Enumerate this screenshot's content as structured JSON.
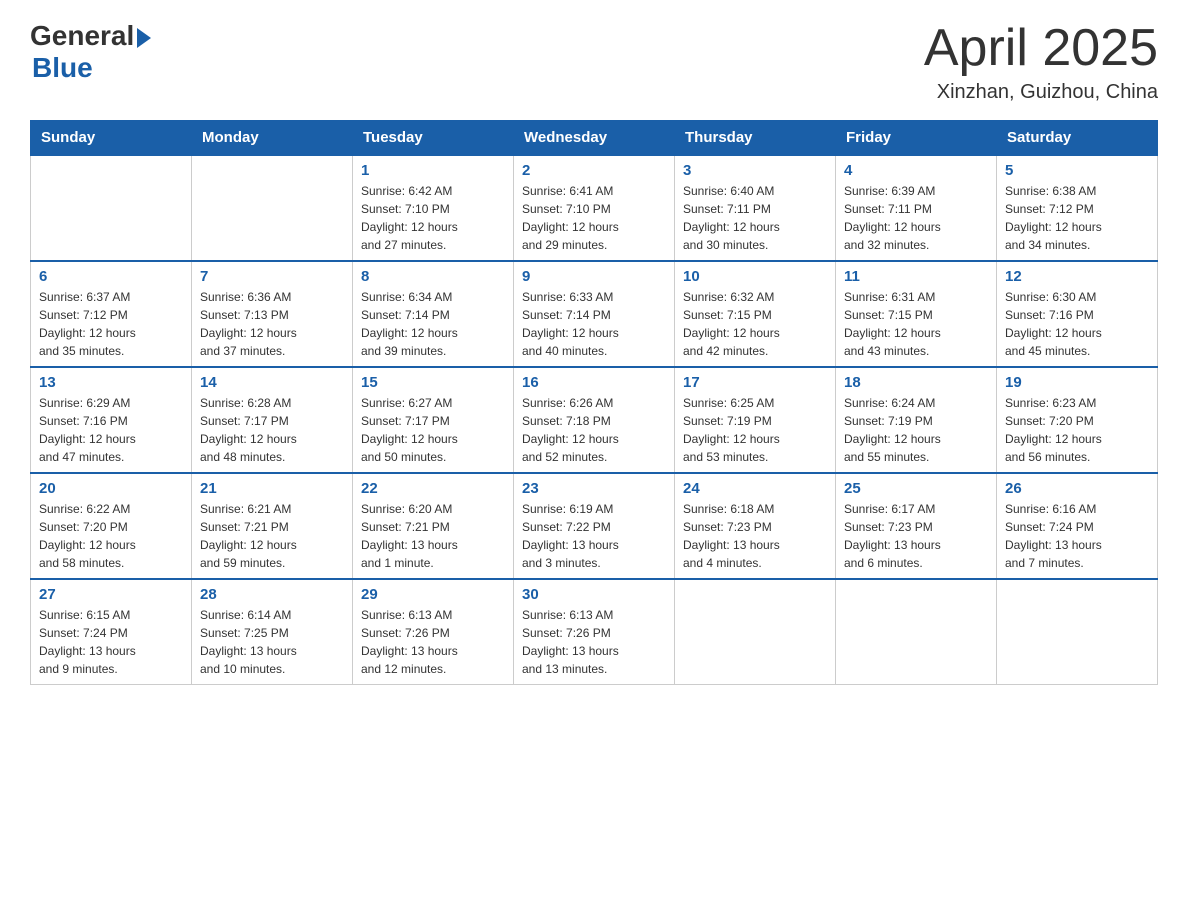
{
  "header": {
    "logo": {
      "general": "General",
      "blue": "Blue"
    },
    "title": "April 2025",
    "subtitle": "Xinzhan, Guizhou, China"
  },
  "days_of_week": [
    "Sunday",
    "Monday",
    "Tuesday",
    "Wednesday",
    "Thursday",
    "Friday",
    "Saturday"
  ],
  "weeks": [
    [
      {
        "day": "",
        "info": ""
      },
      {
        "day": "",
        "info": ""
      },
      {
        "day": "1",
        "info": "Sunrise: 6:42 AM\nSunset: 7:10 PM\nDaylight: 12 hours\nand 27 minutes."
      },
      {
        "day": "2",
        "info": "Sunrise: 6:41 AM\nSunset: 7:10 PM\nDaylight: 12 hours\nand 29 minutes."
      },
      {
        "day": "3",
        "info": "Sunrise: 6:40 AM\nSunset: 7:11 PM\nDaylight: 12 hours\nand 30 minutes."
      },
      {
        "day": "4",
        "info": "Sunrise: 6:39 AM\nSunset: 7:11 PM\nDaylight: 12 hours\nand 32 minutes."
      },
      {
        "day": "5",
        "info": "Sunrise: 6:38 AM\nSunset: 7:12 PM\nDaylight: 12 hours\nand 34 minutes."
      }
    ],
    [
      {
        "day": "6",
        "info": "Sunrise: 6:37 AM\nSunset: 7:12 PM\nDaylight: 12 hours\nand 35 minutes."
      },
      {
        "day": "7",
        "info": "Sunrise: 6:36 AM\nSunset: 7:13 PM\nDaylight: 12 hours\nand 37 minutes."
      },
      {
        "day": "8",
        "info": "Sunrise: 6:34 AM\nSunset: 7:14 PM\nDaylight: 12 hours\nand 39 minutes."
      },
      {
        "day": "9",
        "info": "Sunrise: 6:33 AM\nSunset: 7:14 PM\nDaylight: 12 hours\nand 40 minutes."
      },
      {
        "day": "10",
        "info": "Sunrise: 6:32 AM\nSunset: 7:15 PM\nDaylight: 12 hours\nand 42 minutes."
      },
      {
        "day": "11",
        "info": "Sunrise: 6:31 AM\nSunset: 7:15 PM\nDaylight: 12 hours\nand 43 minutes."
      },
      {
        "day": "12",
        "info": "Sunrise: 6:30 AM\nSunset: 7:16 PM\nDaylight: 12 hours\nand 45 minutes."
      }
    ],
    [
      {
        "day": "13",
        "info": "Sunrise: 6:29 AM\nSunset: 7:16 PM\nDaylight: 12 hours\nand 47 minutes."
      },
      {
        "day": "14",
        "info": "Sunrise: 6:28 AM\nSunset: 7:17 PM\nDaylight: 12 hours\nand 48 minutes."
      },
      {
        "day": "15",
        "info": "Sunrise: 6:27 AM\nSunset: 7:17 PM\nDaylight: 12 hours\nand 50 minutes."
      },
      {
        "day": "16",
        "info": "Sunrise: 6:26 AM\nSunset: 7:18 PM\nDaylight: 12 hours\nand 52 minutes."
      },
      {
        "day": "17",
        "info": "Sunrise: 6:25 AM\nSunset: 7:19 PM\nDaylight: 12 hours\nand 53 minutes."
      },
      {
        "day": "18",
        "info": "Sunrise: 6:24 AM\nSunset: 7:19 PM\nDaylight: 12 hours\nand 55 minutes."
      },
      {
        "day": "19",
        "info": "Sunrise: 6:23 AM\nSunset: 7:20 PM\nDaylight: 12 hours\nand 56 minutes."
      }
    ],
    [
      {
        "day": "20",
        "info": "Sunrise: 6:22 AM\nSunset: 7:20 PM\nDaylight: 12 hours\nand 58 minutes."
      },
      {
        "day": "21",
        "info": "Sunrise: 6:21 AM\nSunset: 7:21 PM\nDaylight: 12 hours\nand 59 minutes."
      },
      {
        "day": "22",
        "info": "Sunrise: 6:20 AM\nSunset: 7:21 PM\nDaylight: 13 hours\nand 1 minute."
      },
      {
        "day": "23",
        "info": "Sunrise: 6:19 AM\nSunset: 7:22 PM\nDaylight: 13 hours\nand 3 minutes."
      },
      {
        "day": "24",
        "info": "Sunrise: 6:18 AM\nSunset: 7:23 PM\nDaylight: 13 hours\nand 4 minutes."
      },
      {
        "day": "25",
        "info": "Sunrise: 6:17 AM\nSunset: 7:23 PM\nDaylight: 13 hours\nand 6 minutes."
      },
      {
        "day": "26",
        "info": "Sunrise: 6:16 AM\nSunset: 7:24 PM\nDaylight: 13 hours\nand 7 minutes."
      }
    ],
    [
      {
        "day": "27",
        "info": "Sunrise: 6:15 AM\nSunset: 7:24 PM\nDaylight: 13 hours\nand 9 minutes."
      },
      {
        "day": "28",
        "info": "Sunrise: 6:14 AM\nSunset: 7:25 PM\nDaylight: 13 hours\nand 10 minutes."
      },
      {
        "day": "29",
        "info": "Sunrise: 6:13 AM\nSunset: 7:26 PM\nDaylight: 13 hours\nand 12 minutes."
      },
      {
        "day": "30",
        "info": "Sunrise: 6:13 AM\nSunset: 7:26 PM\nDaylight: 13 hours\nand 13 minutes."
      },
      {
        "day": "",
        "info": ""
      },
      {
        "day": "",
        "info": ""
      },
      {
        "day": "",
        "info": ""
      }
    ]
  ]
}
